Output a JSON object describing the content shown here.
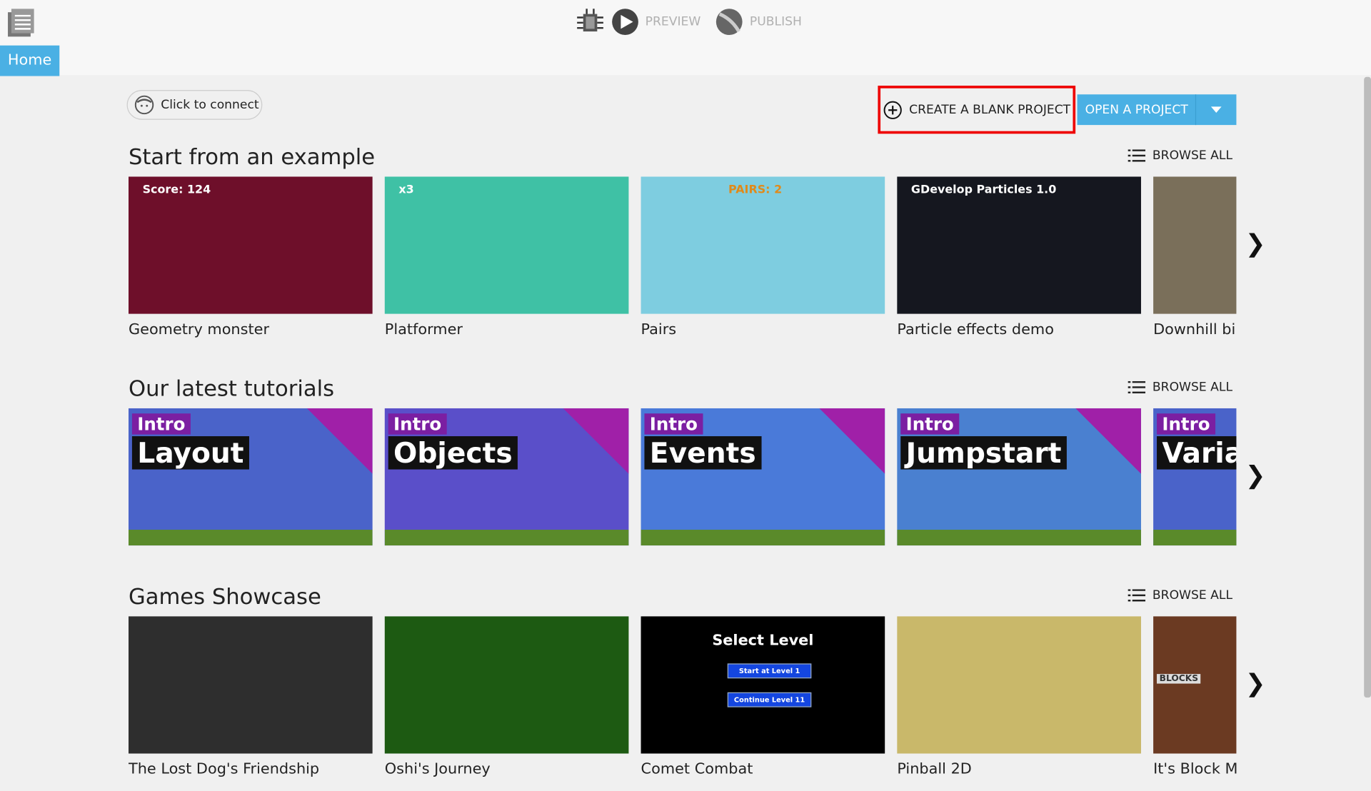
{
  "toolbar": {
    "preview": "PREVIEW",
    "publish": "PUBLISH",
    "home_tab": "Home"
  },
  "connect": {
    "label": "Click to connect"
  },
  "actions": {
    "create_blank": "CREATE A BLANK PROJECT",
    "open_project": "OPEN A PROJECT"
  },
  "sections": [
    {
      "title": "Start from an example",
      "browse": "BROWSE ALL",
      "items": [
        {
          "name": "Geometry monster",
          "thumb_text": "Score: 124",
          "color": "#6e0f2a"
        },
        {
          "name": "Platformer",
          "thumb_text": "x3",
          "color": "#3fc1a5"
        },
        {
          "name": "Pairs",
          "thumb_text": "PAIRS: 2",
          "color": "#7ecde0"
        },
        {
          "name": "Particle effects demo",
          "thumb_text": "GDevelop Particles 1.0",
          "color": "#15171f"
        },
        {
          "name": "Downhill bik",
          "thumb_text": "",
          "color": "#7a6f5a"
        }
      ]
    },
    {
      "title": "Our latest tutorials",
      "browse": "BROWSE ALL",
      "items": [
        {
          "name": "Layout",
          "tag": "Intro",
          "color": "#4a63c9"
        },
        {
          "name": "Objects",
          "tag": "Intro",
          "color": "#5a4fc9"
        },
        {
          "name": "Events",
          "tag": "Intro",
          "color": "#4a7ad9"
        },
        {
          "name": "Jumpstart",
          "tag": "Intro",
          "color": "#4a80d0"
        },
        {
          "name": "Variab",
          "tag": "Intro",
          "color": "#4a63c9"
        }
      ]
    },
    {
      "title": "Games Showcase",
      "browse": "BROWSE ALL",
      "items": [
        {
          "name": "The Lost Dog's Friendship",
          "color": "#2e2e2e"
        },
        {
          "name": "Oshi's Journey",
          "color": "#1d5a12"
        },
        {
          "name": "Comet Combat",
          "color": "#000000",
          "thumb_title": "Select Level",
          "btn1": "Start at Level 1",
          "btn2": "Continue Level 11"
        },
        {
          "name": "Pinball 2D",
          "color": "#c9b86a"
        },
        {
          "name": "It's Block Ma",
          "color": "#6b3a22",
          "thumb_text": "BLOCKS"
        }
      ]
    }
  ],
  "colors": {
    "accent": "#4ab0e4",
    "highlight": "#e00000"
  }
}
